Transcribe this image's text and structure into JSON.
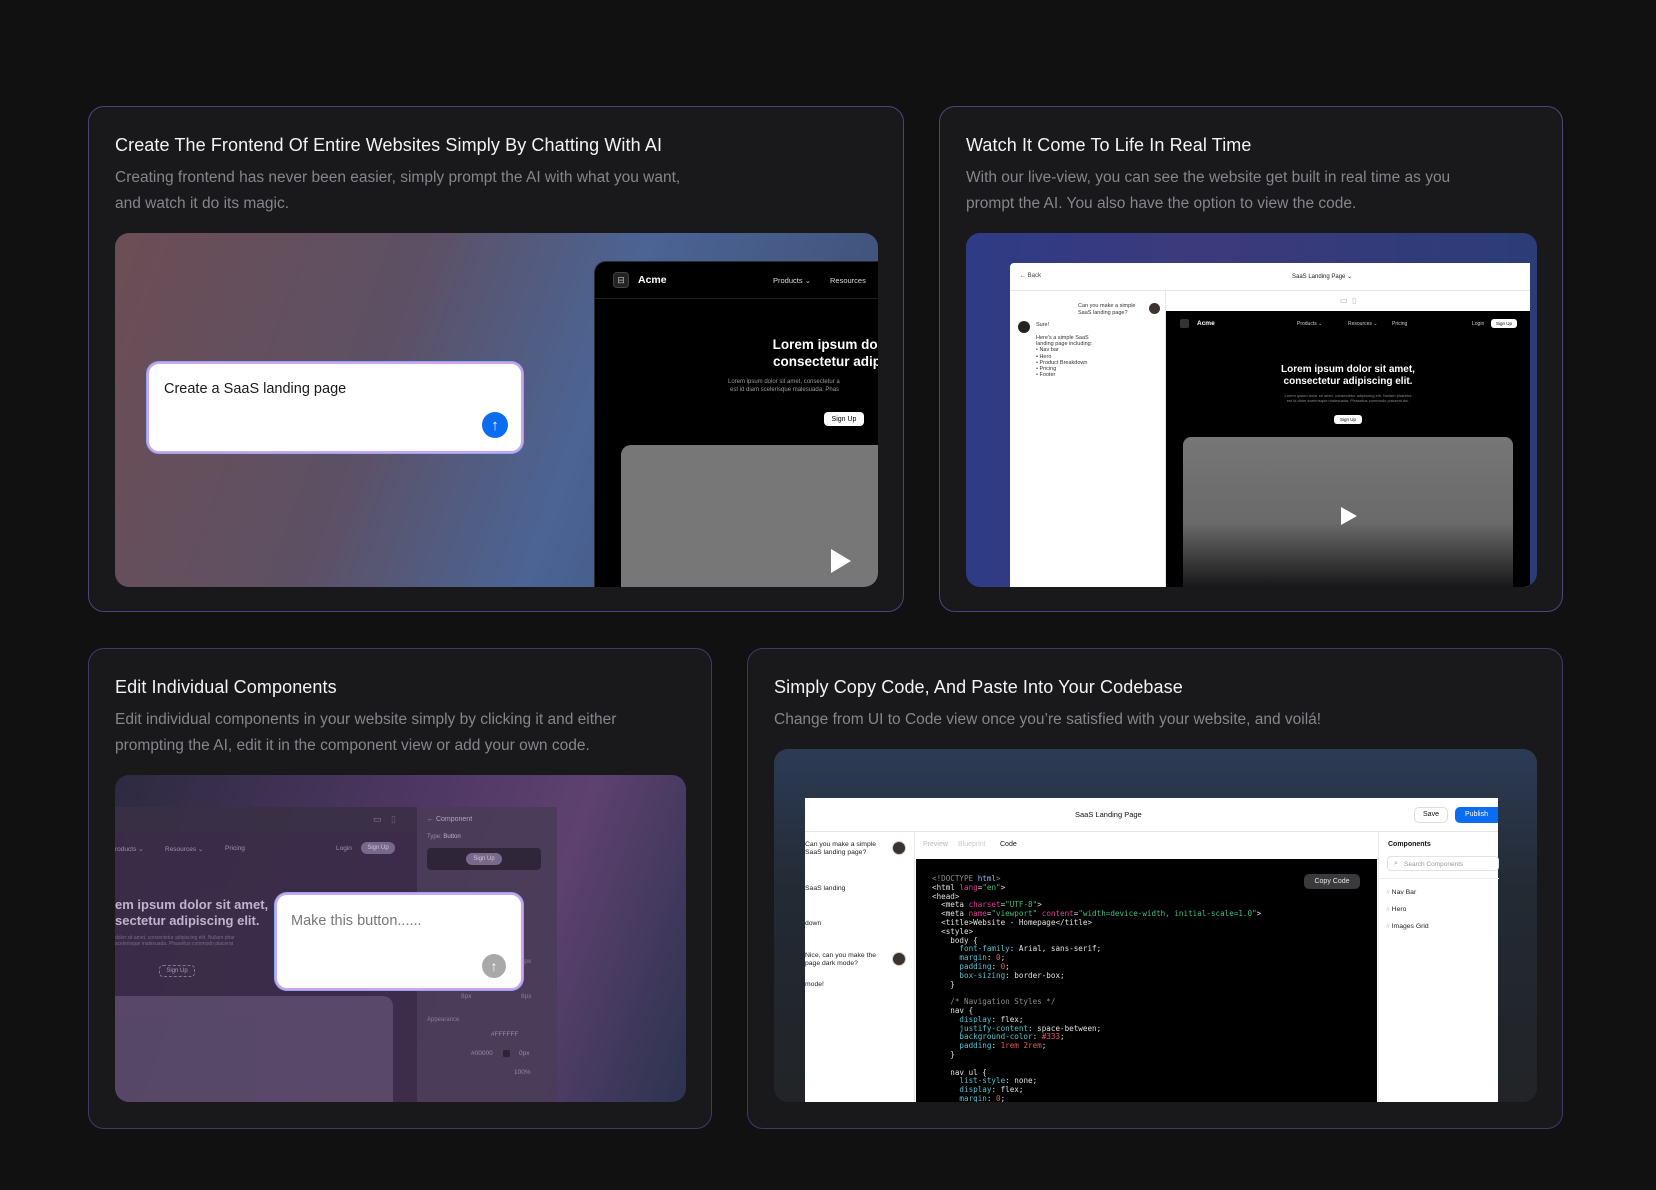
{
  "cards": [
    {
      "title": "Create The Frontend Of Entire Websites Simply By Chatting With AI",
      "desc1": "Creating frontend has never been easier, simply prompt the AI with what you want,",
      "desc2": "and watch it do its magic."
    },
    {
      "title": "Watch It Come To Life In Real Time",
      "desc1": "With our live-view, you can see the website get built in real time as you",
      "desc2": "prompt the AI. You also have the option to view the code."
    },
    {
      "title": "Edit Individual Components",
      "desc1": "Edit individual components in your website simply by clicking it and either",
      "desc2": "prompting the AI, edit it in the component view or add your own code."
    },
    {
      "title": "Simply Copy Code, And Paste Into Your Codebase",
      "desc1": "Change from UI to Code view once you’re satisfied with your website, and voilá!"
    }
  ],
  "demo1": {
    "brand": "Acme",
    "nav_products": "Products",
    "nav_resources": "Resources",
    "hero_line1": "Lorem ipsum dol",
    "hero_line2": "consectetur adip",
    "hero_sub1": "Lorem ipsum dolor sit amet, consectetur a",
    "hero_sub2": "est id diam scelerisque malesuada. Phas",
    "signup": "Sign Up",
    "prompt": "Create a SaaS landing page"
  },
  "demo2": {
    "back": "Back",
    "page_title": "SaaS Landing Page",
    "user_msg": "Can you make a simple SaaS landing page?",
    "ai_sure": "Sure!",
    "ai_body": "Here's a simple SaaS landing page including:",
    "bullets": [
      "• Nav bar",
      "• Hero",
      "• Product Breakdown",
      "• Pricing",
      "• Footer"
    ],
    "brand": "Acme",
    "nav": [
      "Products",
      "Resources",
      "Pricing"
    ],
    "login": "Login",
    "signup": "Sign Up",
    "hero1": "Lorem ipsum dolor sit amet,",
    "hero2": "consectetur adipiscing elit.",
    "sub1": "Lorem ipsum dolor sit amet, consectetur adipiscing elit. Nullam pharetra",
    "sub2": "est id diam scelerisque malesuada. Phasellus commodo placerat dui."
  },
  "demo3": {
    "nav": [
      "roducts",
      "Resources",
      "Pricing"
    ],
    "login": "Login",
    "signup": "Sign Up",
    "hero1": "em ipsum dolor sit amet,",
    "hero2": "sectetur adipiscing elit.",
    "sub1": "dolor sit amet, consectetur adipiscing elit. Nullam phar",
    "sub2": "scelerisque malesuada. Phasellus commodo placerat",
    "panel_title": "Component",
    "type_label": "Type:",
    "type_value": "Button",
    "prompt_placeholder": "Make this button......",
    "px48": "48px",
    "px8a": "8px",
    "px8b": "8px",
    "appearance": "Appearance",
    "fill": "#FFFFFF",
    "stroke": "#00000",
    "stroke_px": "0px",
    "opacity": "100%"
  },
  "demo4": {
    "title": "SaaS Landing Page",
    "save": "Save",
    "publish": "Publish",
    "tabs": [
      "Preview",
      "Blueprint",
      "Code"
    ],
    "chat1": "Can you make a simple SaaS landing page?",
    "chat2": "SaaS landing",
    "chat3": "down",
    "chat4": "Nice, can you make the page dark mode?",
    "chat5": "mode!",
    "copy": "Copy Code",
    "components_title": "Components",
    "search_placeholder": "Search Components",
    "components": [
      "Nav Bar",
      "Hero",
      "Images Grid"
    ]
  }
}
